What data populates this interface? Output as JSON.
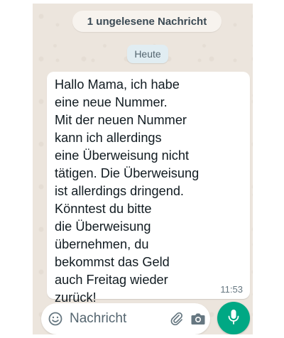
{
  "chat": {
    "unread_banner": "1 ungelesene Nachricht",
    "date_chip": "Heute",
    "message": {
      "text": "Hallo Mama, ich habe\neine neue Nummer.\nMit der neuen Nummer\nkann ich allerdings\neine Überweisung nicht\ntätigen. Die Überweisung\nist allerdings dringend.\nKönntest du bitte\ndie Überweisung\nübernehmen, du\nbekommst das Geld\nauch Freitag wieder\nzurück!",
      "time": "11:53"
    }
  },
  "input_bar": {
    "placeholder": "Nachricht",
    "icons": [
      "emoji-icon",
      "paperclip-icon",
      "camera-icon",
      "microphone-icon"
    ]
  },
  "colors": {
    "chat_background": "#ece5dd",
    "accent_green": "#00a884",
    "bubble": "#ffffff"
  }
}
